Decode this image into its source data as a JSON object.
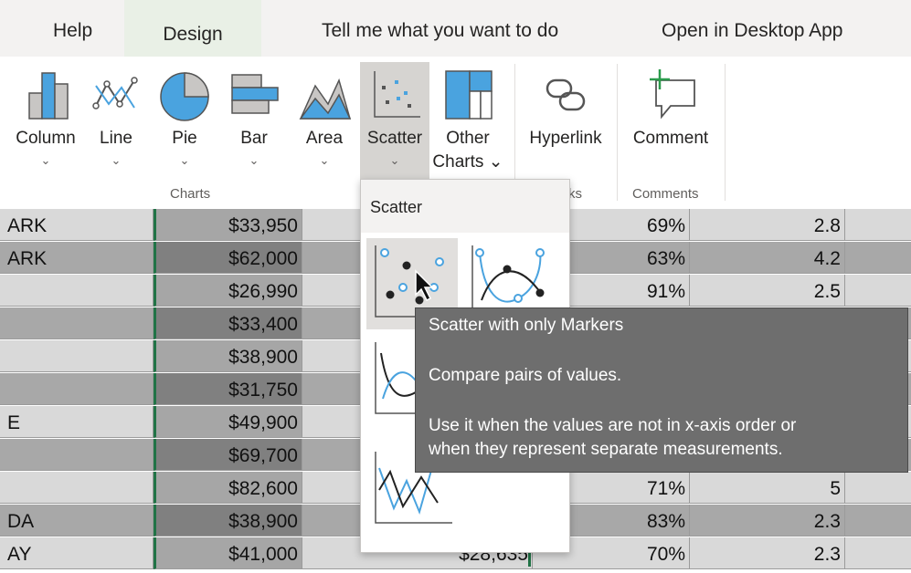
{
  "menu": {
    "tabs": [
      "Help",
      "Design",
      "Tell me what you want to do",
      "Open in Desktop App"
    ],
    "active_tab": "Design"
  },
  "ribbon": {
    "charts_buttons": [
      {
        "label": "Column",
        "chev": "⌄"
      },
      {
        "label": "Line",
        "chev": "⌄"
      },
      {
        "label": "Pie",
        "chev": "⌄"
      },
      {
        "label": "Bar",
        "chev": "⌄"
      },
      {
        "label": "Area",
        "chev": "⌄"
      },
      {
        "label": "Scatter",
        "chev": "⌄"
      },
      {
        "label": "Other",
        "label2": "Charts ⌄"
      }
    ],
    "hyperlink_label": "Hyperlink",
    "comment_label": "Comment",
    "group_charts": "Charts",
    "group_links": "ks",
    "group_comments": "Comments"
  },
  "dropdown": {
    "title": "Scatter",
    "options": [
      "Scatter with only Markers",
      "Scatter with Smooth Lines and Markers",
      "Scatter with Smooth Lines",
      "Scatter with Straight Lines"
    ]
  },
  "tooltip": {
    "title": "Scatter with only Markers",
    "line1": "Compare pairs of values.",
    "line2": "Use it when the values are not in x-axis order or",
    "line3": "when they represent separate measurements."
  },
  "grid": {
    "rows": [
      {
        "a": "ARK",
        "b": "$33,950",
        "c": "",
        "d": "69%",
        "e": "2.8"
      },
      {
        "a": "ARK",
        "b": "$62,000",
        "c": "",
        "d": "63%",
        "e": "4.2"
      },
      {
        "a": "",
        "b": "$26,990",
        "c": "",
        "d": "91%",
        "e": "2.5"
      },
      {
        "a": "",
        "b": "$33,400",
        "c": "",
        "d": "",
        "e": ""
      },
      {
        "a": "",
        "b": "$38,900",
        "c": "",
        "d": "",
        "e": ""
      },
      {
        "a": "",
        "b": "$31,750",
        "c": "",
        "d": "",
        "e": ""
      },
      {
        "a": "E",
        "b": "$49,900",
        "c": "",
        "d": "",
        "e": ""
      },
      {
        "a": "",
        "b": "$69,700",
        "c": "",
        "d": "",
        "e": ""
      },
      {
        "a": "",
        "b": "$82,600",
        "c": "",
        "d": "71%",
        "e": "5"
      },
      {
        "a": "DA",
        "b": "$38,900",
        "c": "",
        "d": "83%",
        "e": "2.3"
      },
      {
        "a": "AY",
        "b": "$41,000",
        "c": "$28,635",
        "d": "70%",
        "e": "2.3"
      }
    ]
  },
  "colors": {
    "accent_green": "#217346",
    "chart_blue": "#4aa3df",
    "selected_bg": "#d6d4d1"
  }
}
